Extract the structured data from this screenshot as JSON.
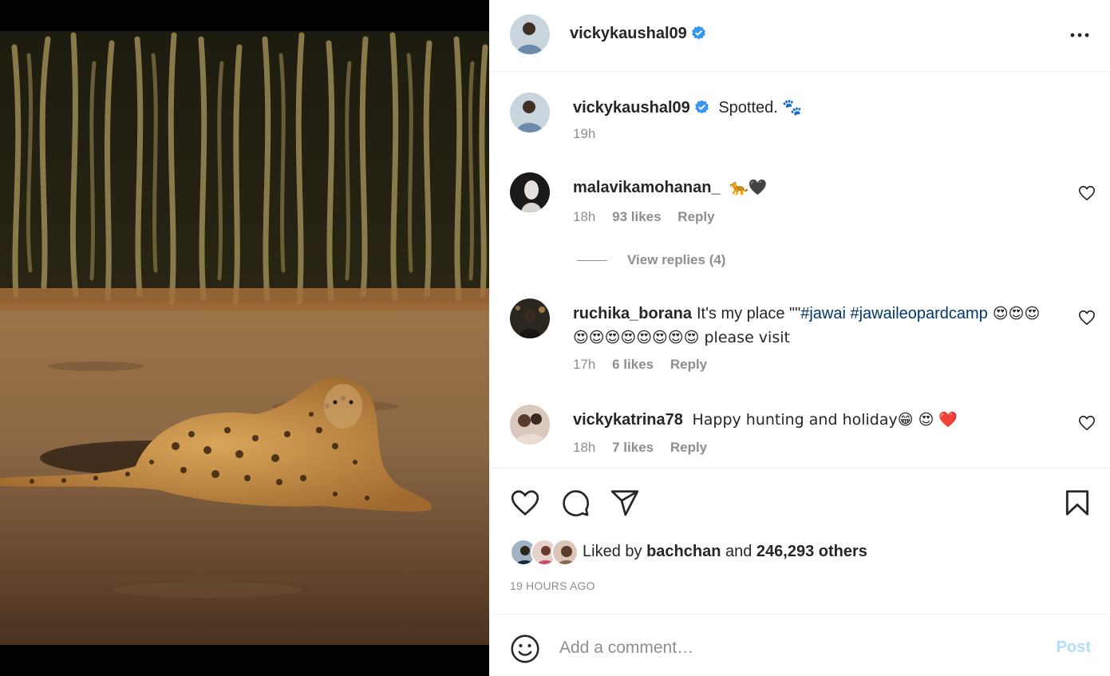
{
  "post": {
    "author": "vickykaushal09",
    "caption": "Spotted. 🐾",
    "caption_time": "19h"
  },
  "comments": [
    {
      "user": "malavikamohanan_",
      "text": "🐆🖤",
      "time": "18h",
      "likes": "93 likes",
      "reply": "Reply",
      "view_replies": "View replies (4)"
    },
    {
      "user": "ruchika_borana",
      "text_pre": "It's my place \"\"",
      "tags": "#jawai #jawaileopardcamp",
      "text_post": " 😍😍😍😍😍😍😍😍😍😍😍 please visit",
      "time": "17h",
      "likes": "6 likes",
      "reply": "Reply"
    },
    {
      "user": "vickykatrina78",
      "text": "Happy hunting and holiday😁 😍 ❤️",
      "time": "18h",
      "likes": "7 likes",
      "reply": "Reply"
    }
  ],
  "liked": {
    "prefix": "Liked by ",
    "user": "bachchan",
    "and": " and ",
    "others": "246,293 others"
  },
  "timestamp": "19 HOURS AGO",
  "add_comment": {
    "placeholder": "Add a comment…",
    "post_label": "Post"
  },
  "icons": {
    "verified": "verified-badge-icon",
    "more": "more-options-icon",
    "like": "heart-icon",
    "comment": "comment-icon",
    "share": "share-icon",
    "save": "bookmark-icon",
    "emoji": "emoji-icon"
  },
  "colors": {
    "verified_blue": "#3897f0",
    "hashtag": "#00376b",
    "post_disabled": "#b2dffc",
    "meta_gray": "#8e8e8e"
  }
}
